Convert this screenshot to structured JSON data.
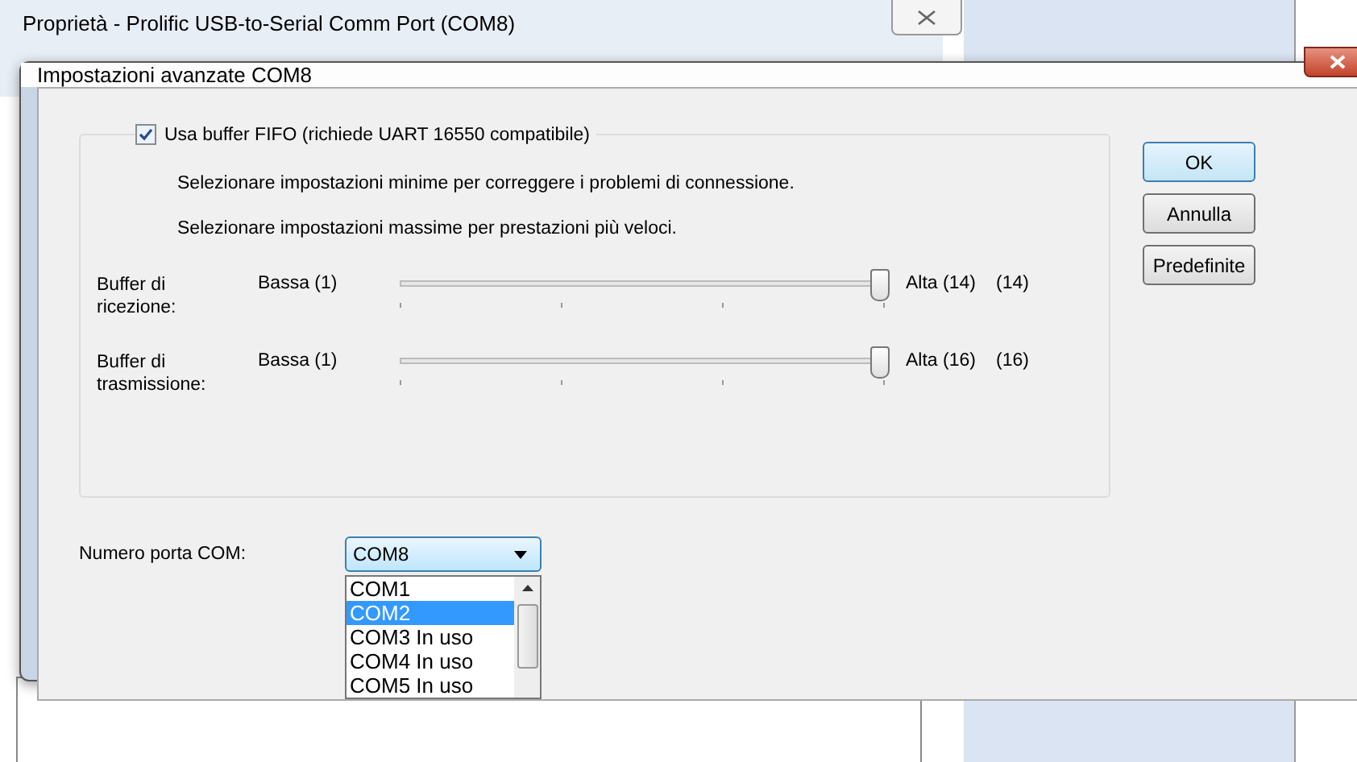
{
  "back_window": {
    "title": "Proprietà - Prolific USB-to-Serial Comm Port (COM8)"
  },
  "dialog": {
    "title": "Impostazioni avanzate COM8"
  },
  "fifo": {
    "label": "Usa buffer FIFO (richiede UART 16550 compatibile)",
    "checked": true
  },
  "hints": [
    "Selezionare impostazioni minime per correggere i problemi di connessione.",
    "Selezionare impostazioni massime per prestazioni più veloci."
  ],
  "sliders": [
    {
      "label": "Buffer di ricezione:",
      "min_label": "Bassa (1)",
      "max_label": "Alta (14)",
      "reading": "(14)",
      "level": 1
    },
    {
      "label": "Buffer di trasmissione:",
      "min_label": "Bassa (1)",
      "max_label": "Alta (16)",
      "reading": "(16)",
      "level": 1
    }
  ],
  "buttons": [
    {
      "label": "OK",
      "default": true
    },
    {
      "label": "Annulla",
      "default": false
    },
    {
      "label": "Predefinite",
      "default": false
    }
  ],
  "com_port": {
    "label": "Numero porta COM:",
    "value": "COM8",
    "options": [
      {
        "label": "COM1",
        "selected": false
      },
      {
        "label": "COM2",
        "selected": true
      },
      {
        "label": "COM3 In uso",
        "selected": false
      },
      {
        "label": "COM4 In uso",
        "selected": false
      },
      {
        "label": "COM5 In uso",
        "selected": false
      }
    ]
  }
}
